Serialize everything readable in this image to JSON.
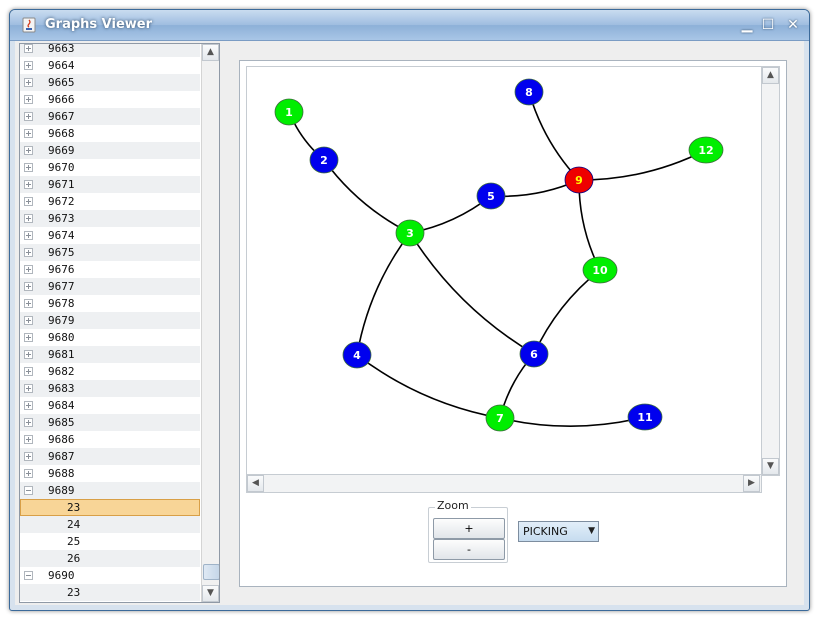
{
  "window": {
    "title": "Graphs Viewer",
    "controls": {
      "minimize": "▁",
      "maximize": "☐",
      "close": "✕"
    }
  },
  "tree": {
    "rows": [
      {
        "label": "9663",
        "type": "node"
      },
      {
        "label": "9664",
        "type": "node"
      },
      {
        "label": "9665",
        "type": "node"
      },
      {
        "label": "9666",
        "type": "node"
      },
      {
        "label": "9667",
        "type": "node"
      },
      {
        "label": "9668",
        "type": "node"
      },
      {
        "label": "9669",
        "type": "node"
      },
      {
        "label": "9670",
        "type": "node"
      },
      {
        "label": "9671",
        "type": "node"
      },
      {
        "label": "9672",
        "type": "node"
      },
      {
        "label": "9673",
        "type": "node"
      },
      {
        "label": "9674",
        "type": "node"
      },
      {
        "label": "9675",
        "type": "node"
      },
      {
        "label": "9676",
        "type": "node"
      },
      {
        "label": "9677",
        "type": "node"
      },
      {
        "label": "9678",
        "type": "node"
      },
      {
        "label": "9679",
        "type": "node"
      },
      {
        "label": "9680",
        "type": "node"
      },
      {
        "label": "9681",
        "type": "node"
      },
      {
        "label": "9682",
        "type": "node"
      },
      {
        "label": "9683",
        "type": "node"
      },
      {
        "label": "9684",
        "type": "node"
      },
      {
        "label": "9685",
        "type": "node"
      },
      {
        "label": "9686",
        "type": "node"
      },
      {
        "label": "9687",
        "type": "node"
      },
      {
        "label": "9688",
        "type": "node"
      },
      {
        "label": "9689",
        "type": "expanded"
      },
      {
        "label": "23",
        "type": "child",
        "selected": true
      },
      {
        "label": "24",
        "type": "child"
      },
      {
        "label": "25",
        "type": "child"
      },
      {
        "label": "26",
        "type": "child"
      },
      {
        "label": "9690",
        "type": "expanded"
      },
      {
        "label": "23",
        "type": "child"
      }
    ]
  },
  "graph": {
    "nodes": [
      {
        "id": "1",
        "color": "#00ee00",
        "text_color": "#ffffff"
      },
      {
        "id": "2",
        "color": "#0000ee",
        "text_color": "#ffffff"
      },
      {
        "id": "3",
        "color": "#00ee00",
        "text_color": "#ffffff"
      },
      {
        "id": "4",
        "color": "#0000ee",
        "text_color": "#ffffff"
      },
      {
        "id": "5",
        "color": "#0000ee",
        "text_color": "#ffffff"
      },
      {
        "id": "6",
        "color": "#0000ee",
        "text_color": "#ffffff"
      },
      {
        "id": "7",
        "color": "#00ee00",
        "text_color": "#ffffff"
      },
      {
        "id": "8",
        "color": "#0000ee",
        "text_color": "#ffffff"
      },
      {
        "id": "9",
        "color": "#ee0000",
        "text_color": "#ffff00"
      },
      {
        "id": "10",
        "color": "#00ee00",
        "text_color": "#ffffff"
      },
      {
        "id": "11",
        "color": "#0000ee",
        "text_color": "#ffffff"
      },
      {
        "id": "12",
        "color": "#00ee00",
        "text_color": "#ffffff"
      }
    ],
    "edges": [
      [
        "1",
        "2"
      ],
      [
        "2",
        "3"
      ],
      [
        "3",
        "5"
      ],
      [
        "5",
        "9"
      ],
      [
        "8",
        "9"
      ],
      [
        "9",
        "12"
      ],
      [
        "9",
        "10"
      ],
      [
        "10",
        "6"
      ],
      [
        "3",
        "6"
      ],
      [
        "3",
        "4"
      ],
      [
        "4",
        "7"
      ],
      [
        "6",
        "7"
      ],
      [
        "7",
        "11"
      ]
    ]
  },
  "zoom": {
    "legend": "Zoom",
    "plus": "+",
    "minus": "-"
  },
  "mode": {
    "selected": "PICKING"
  }
}
